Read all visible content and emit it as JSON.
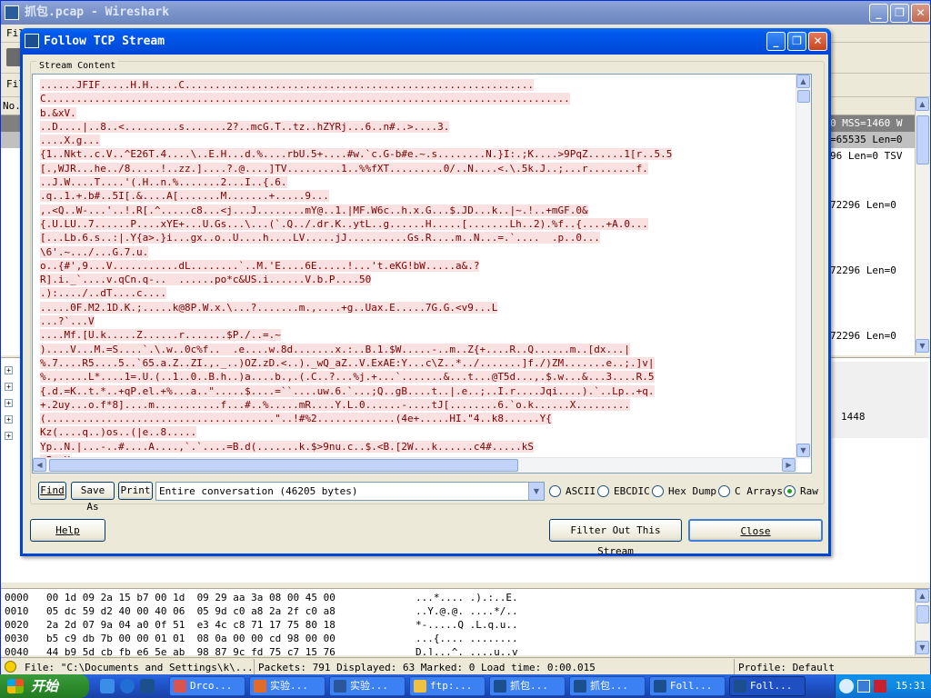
{
  "main_window": {
    "title": "抓包.pcap - Wireshark",
    "menu_text": "Fil",
    "filter_text": "Fil",
    "col_no": "No.",
    "packet_rows": [
      {
        "info": "0 MSS=1460 W",
        "style": "sel"
      },
      {
        "info": "=65535 Len=0",
        "style": "gray"
      },
      {
        "info": "96 Len=0 TSV",
        "style": "white"
      },
      {
        "info": "",
        "style": "white"
      },
      {
        "info": "",
        "style": "white"
      },
      {
        "info": "72296 Len=0",
        "style": "white"
      },
      {
        "info": "",
        "style": "white"
      },
      {
        "info": "",
        "style": "white"
      },
      {
        "info": "",
        "style": "white"
      },
      {
        "info": "72296 Len=0",
        "style": "white"
      },
      {
        "info": "",
        "style": "white"
      },
      {
        "info": "",
        "style": "white"
      },
      {
        "info": "",
        "style": "white"
      },
      {
        "info": "72296 Len=0",
        "style": "white"
      }
    ],
    "detail_value": "1448",
    "hex_rows": [
      {
        "offset": "0000",
        "hex": "00 1d 09 2a 15 b7 00 1d  09 29 aa 3a 08 00 45 00",
        "ascii": "...*.... .).:..E."
      },
      {
        "offset": "0010",
        "hex": "05 dc 59 d2 40 00 40 06  05 9d c0 a8 2a 2f c0 a8",
        "ascii": "..Y.@.@. ....*/.."
      },
      {
        "offset": "0020",
        "hex": "2a 2d 07 9a 04 a0 0f 51  e3 4c c8 71 17 75 80 18",
        "ascii": "*-.....Q .L.q.u.."
      },
      {
        "offset": "0030",
        "hex": "b5 c9 db 7b 00 00 01 01  08 0a 00 00 cd 98 00 00",
        "ascii": "...{.... ........"
      },
      {
        "offset": "0040",
        "hex": "44 b9 5d cb fb e6 5e ab  98 87 9c fd 75 c7 15 76",
        "ascii": "D.]...^. ....u..v"
      }
    ],
    "status": {
      "file": "File: \"C:\\Documents and Settings\\k\\...",
      "packets": "Packets: 791 Displayed: 63 Marked: 0 Load time: 0:00.015",
      "profile": "Profile: Default"
    }
  },
  "dialog": {
    "title": "Follow TCP Stream",
    "group_label": "Stream Content",
    "stream_lines": [
      "......JFIF.....H.H.....C..........................................................",
      "C.......................................................................................",
      "b.&xV.",
      "..D....|..8..<.........s.......2?..mcG.T..tz..hZYRj...6..n#..>....3.",
      "....X.g...",
      "{1..Nkt..c.V..^E26T.4....\\..E.H...d.%....rbU.5+....#w.`c.G-b#e.~.s........N.}I:.;K....>9PqZ......1[r..5.5",
      "[.,WJR...he../8.....!..zz.]....?.@....]TV.........1..%%fXT.........0/..N....<.\\.5k.J..;...r........f.",
      "..J.W....T....'(.H..n.%.......2...I..{.6.",
      ".q..1.+.b#..5I[.&....A[.......M.......+.....9...",
      ",.<Q..W-...'..!.R[.^.....c8...<j...J........mY@..1.|MF.W6c..h.x.G...$.JD...k..|~.!..+mGF.0&",
      "{.U.LU..7......P....xYE+...U.Gs...\\...(`.Q../.dr.K..ytL..g......H.....[.......Lh..2).%f..{....+A.0...",
      "[...Lb.6.s..:|.Y{a>.}i...gx..o..U....h....LV.....jJ..........Gs.R....m..N...=.`....  .p..0...",
      "\\6'.~.../...G.7.u.",
      "o..{#',9...V...........dL........`..M.'E....6E.....!...'t.eKG!bW.....a&.?",
      "R].i._`....v.qCn.q-..  ......po*c&US.i......V.b.P....50",
      ".):..../..dT....c....",
      ".....0F.M2.1D.K.;.....k@8P.W.x.\\...?.......m.,....+g..Uax.E.....7G.G.<v9...L",
      "...?`...V",
      "....Mf.[U.k.....Z......r.......$P./..=.~",
      ")....V...M.=S....`.\\.w..0c%f..  .e....w.8d.......x.:..B.1.$W.....-..m..Z{+....R..Q......m..[dx...|",
      "%.7....R5....5..`65.a.Z..ZI.,._..)OZ.zD.<..)._wQ_aZ..V.ExAE:Y...c\\Z..*../.......]f./)ZM.......e..;.]v|",
      "%.,.....L*....1=.U.(..1..0..B.h..)a....b.,.(.C..?...%j.+...`.......&...t...@T5d...,.$.w...&...3....R.5",
      "{.d.=K..t.*..+qP.el.+%...a..\".....$....=``....uw.6.`...;Q..gB....t..|.e..;..I.r....Jqi....).`..Lp..+q.",
      "+.2uy...o.f*8]....m...........f...#..%.....mR....Y.L.0......-....tJ[........6.`o.k......X.........",
      "(......................................\"..!#%2.............(4e+.....HI.\"4..k8......Y{",
      "Kz(....q..)os..(|e..8.....",
      "Yp..N.|...-..#....A....,`.`....=B.d(.......k.$>9nu.c..$.<B.[2W...k......c4#.....kS",
      ".I.sH"
    ],
    "buttons": {
      "find": "Find",
      "save_as": "Save As",
      "print": "Print",
      "help": "Help",
      "filter_out": "Filter Out This Stream",
      "close": "Close"
    },
    "conversation": "Entire conversation (46205 bytes)",
    "radio_options": [
      {
        "label": "ASCII",
        "selected": false
      },
      {
        "label": "EBCDIC",
        "selected": false
      },
      {
        "label": "Hex Dump",
        "selected": false
      },
      {
        "label": "C Arrays",
        "selected": false
      },
      {
        "label": "Raw",
        "selected": true
      }
    ]
  },
  "taskbar": {
    "start": "开始",
    "items": [
      {
        "label": "Drco...",
        "color": "#d9534f"
      },
      {
        "label": "实验...",
        "color": "#e26b2a"
      },
      {
        "label": "实验...",
        "color": "#2b579a"
      },
      {
        "label": "ftp:...",
        "color": "#f0c040"
      },
      {
        "label": "抓包...",
        "color": "#1b4f8e"
      },
      {
        "label": "抓包...",
        "color": "#1b4f8e"
      },
      {
        "label": "Foll...",
        "color": "#1b4f8e"
      },
      {
        "label": "Foll...",
        "color": "#1b4f8e"
      }
    ],
    "clock": "15:31"
  }
}
